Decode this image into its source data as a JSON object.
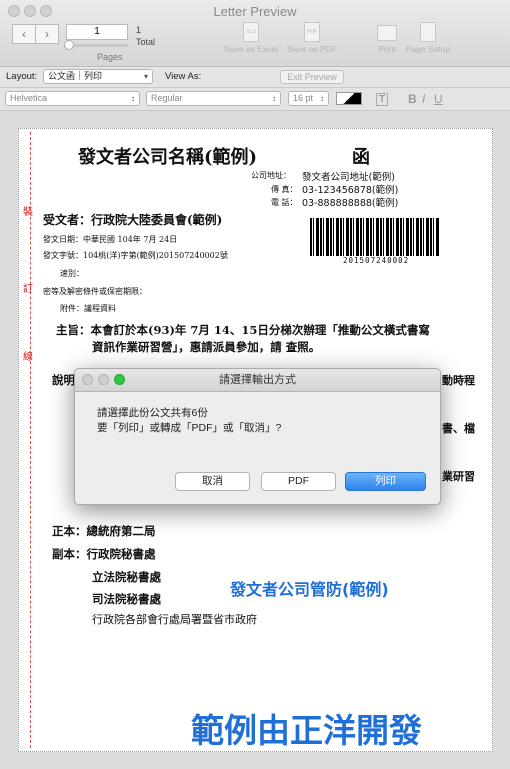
{
  "window": {
    "title": "Letter Preview",
    "toolbar": {
      "page_number": "1",
      "total_count": "1",
      "total_label": "Total",
      "pages_label": "Pages",
      "save_excel": "Save as Excel",
      "save_pdf": "Save as PDF",
      "print": "Print",
      "page_setup": "Page Setup",
      "xls_icon_text": "XLS",
      "pdf_icon_text": "PDF"
    },
    "format_bar": {
      "layout_label": "Layout:",
      "layout_value": "公文函｜列印",
      "view_as_label": "View As:",
      "exit_preview": "Exit Preview",
      "font_value": "Helvetica",
      "style_value": "Regular",
      "size_value": "16 pt"
    }
  },
  "document": {
    "title": "發文者公司名稱(範例)",
    "doc_type": "函",
    "address_label": "公司地址：",
    "address_value": "發文者公司地址(範例)",
    "fax_label": "傳 真：",
    "fax_value": "03-123456878(範例)",
    "phone_label": "電 話：",
    "phone_value": "03-888888888(範例)",
    "recipient": "受文者：行政院大陸委員會(範例)",
    "date_line": "發文日期：中華民國 104年 7月 24日",
    "number_line": "發文字號：104桃(洋)字第(範例)201507240002號",
    "speed_line": "速別：",
    "secret_line": "密等及解密條件或保密期限：",
    "attach_line": "附件：議程資料",
    "subject_line1": "主旨：本會訂於本(93)年 7月 14、15日分梯次辦理「推動公文橫式書寫",
    "subject_line2": "資訊作業研習營」，惠請派員參加，請 查照。",
    "desc_label": "說明",
    "partial_right1": "動時程",
    "partial_right2": "書、檔",
    "partial_right3": "業研習",
    "barcode_number": "201507240002",
    "main_to": "正本：總統府第二局",
    "copy_to_1": "副本：行政院秘書處",
    "copy_to_2": "立法院秘書處",
    "copy_to_3": "司法院秘書處",
    "copy_to_4": "行政院各部會行處局署暨省市政府",
    "margin_chars": [
      "裝",
      "訂",
      "線"
    ],
    "blue_label": "發文者公司管防(範例)",
    "watermark": "範例由正洋開發"
  },
  "dialog": {
    "title": "請選擇輸出方式",
    "message_line1": "請選擇此份公文共有6份",
    "message_line2": "要「列印」或轉成「PDF」或「取消」?",
    "cancel_label": "取消",
    "pdf_label": "PDF",
    "print_label": "列印"
  },
  "colors": {
    "accent_blue": "#1f6fd6",
    "margin_red": "#d02020",
    "primary_button": "#3b8eea"
  }
}
